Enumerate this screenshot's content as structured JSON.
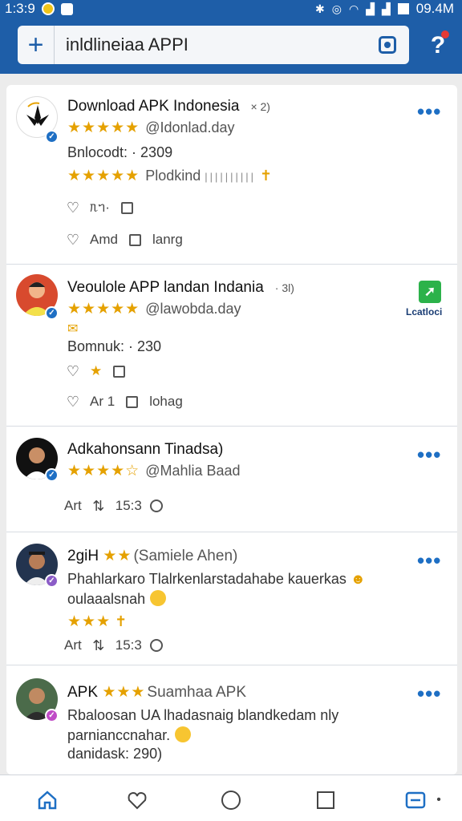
{
  "status_bar": {
    "time": "1:3:9",
    "right_time": "09.4M"
  },
  "header": {
    "add_label": "+",
    "search_text": "inldlineiaa APPI",
    "help_label": "?"
  },
  "posts": [
    {
      "title": "Download APK Indonesia",
      "title_suffix": "× 2)",
      "stars": "★★★★★",
      "handle": "@Idonlad.day",
      "line2": "Bnlocodt: · 2309",
      "line3_stars": "★★★★★",
      "line3_text": "Plodkind",
      "action1_text": "ᥰᥐ·",
      "action2_like": "Amd",
      "action2_comment": "lanrg"
    },
    {
      "title": "Veoulole APP landan Indania",
      "title_suffix": "· 3l)",
      "stars": "★★★★★",
      "handle": "@lawobda.day",
      "badge_label": "Lcatloci",
      "line3": "Bomnuk: · 230",
      "action2_like": "Ar 1",
      "action2_comment": "lohag"
    },
    {
      "title": "Adkahonsann Tinadsa)",
      "stars": "★★★★☆",
      "handle": "@Mahlia Baad",
      "action_text": "Art",
      "action_count": "15:3"
    },
    {
      "title": "2giH",
      "stars": "★★",
      "handle": "(Samiele Ahen)",
      "line1": "Phahlarkaro Tlalrkenlarstadahabe kauerkas",
      "line2": "oulaaalsnah",
      "line3_stars": "★★★",
      "action_text": "Art",
      "action_count": "15:3"
    },
    {
      "title": "APK",
      "stars": "★★★",
      "handle": "Suamhaa APK",
      "line1": "Rbaloosan UA lhadasnaig blandkedam nly",
      "line2": "parnianccnahar.",
      "line3": "danidask: 290)"
    }
  ],
  "colors": {
    "brand": "#1e5ea8",
    "star": "#e5a100",
    "accent_blue": "#1e6fc4",
    "badge_green": "#2cb24a"
  },
  "icons": [
    "search-icon",
    "camera-icon",
    "more-icon",
    "heart-icon",
    "comment-icon",
    "share-icon",
    "home-icon",
    "recent-icon"
  ]
}
